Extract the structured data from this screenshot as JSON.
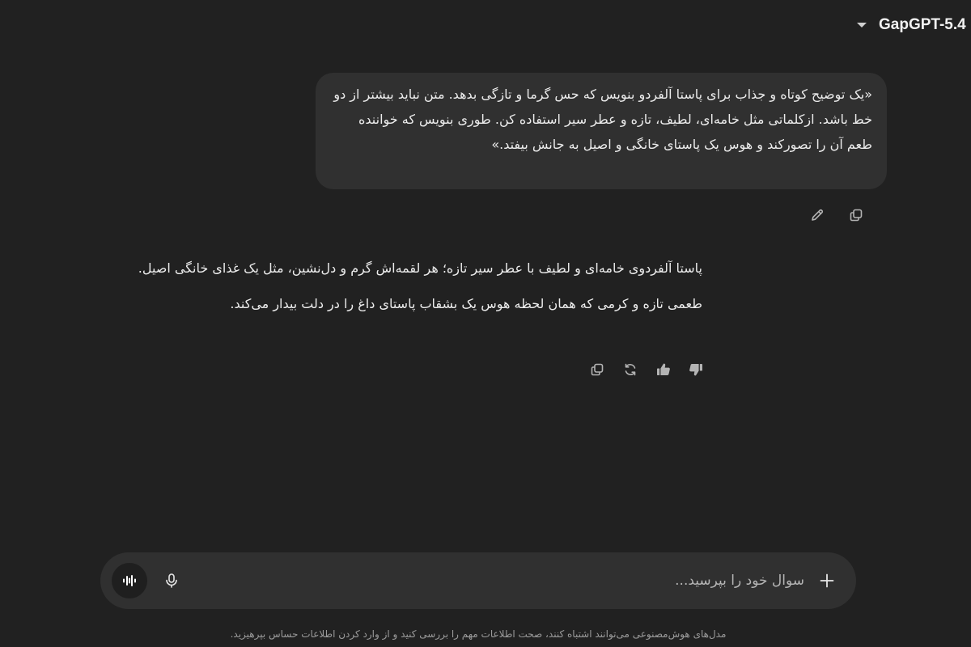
{
  "header": {
    "model_name": "GapGPT-5.4"
  },
  "user_message": {
    "text": "«یک توضیح کوتاه و جذاب برای پاستا آلفردو بنویس که حس گرما و تازگی بدهد. متن نباید بیشتر از دو خط باشد. ازکلماتی مثل خامه‌ای، لطیف، تازه و عطر سیر استفاده کن. طوری بنویس که خواننده طعم آن را تصورکند و هوس یک پاستای خانگی و اصیل به جانش بیفتد.»"
  },
  "assistant_message": {
    "lines": [
      "پاستا آلفردوی خامه‌ای و لطیف با عطر سیر تازه؛ هر لقمه‌اش گرم و دل‌نشین، مثل یک غذای خانگی اصیل.",
      "طعمی تازه و کرمی که همان لحظه هوس یک بشقاب پاستای داغ را در دلت بیدار می‌کند."
    ]
  },
  "composer": {
    "placeholder": "سوال خود را بپرسید..."
  },
  "footer": {
    "disclaimer": "مدل‌های هوش‌مصنوعی می‌توانند اشتباه کنند، صحت اطلاعات مهم را بررسی کنید و از وارد کردن اطلاعات حساس بپرهیزید."
  },
  "icons": {
    "model_dropdown": "chevron-down-icon",
    "edit": "pencil-icon",
    "copy": "copy-icon",
    "regenerate": "refresh-icon",
    "like": "thumbs-up-icon",
    "dislike": "thumbs-down-icon",
    "attach": "plus-icon",
    "dictate": "microphone-icon",
    "voice_mode": "voice-waveform-icon"
  }
}
